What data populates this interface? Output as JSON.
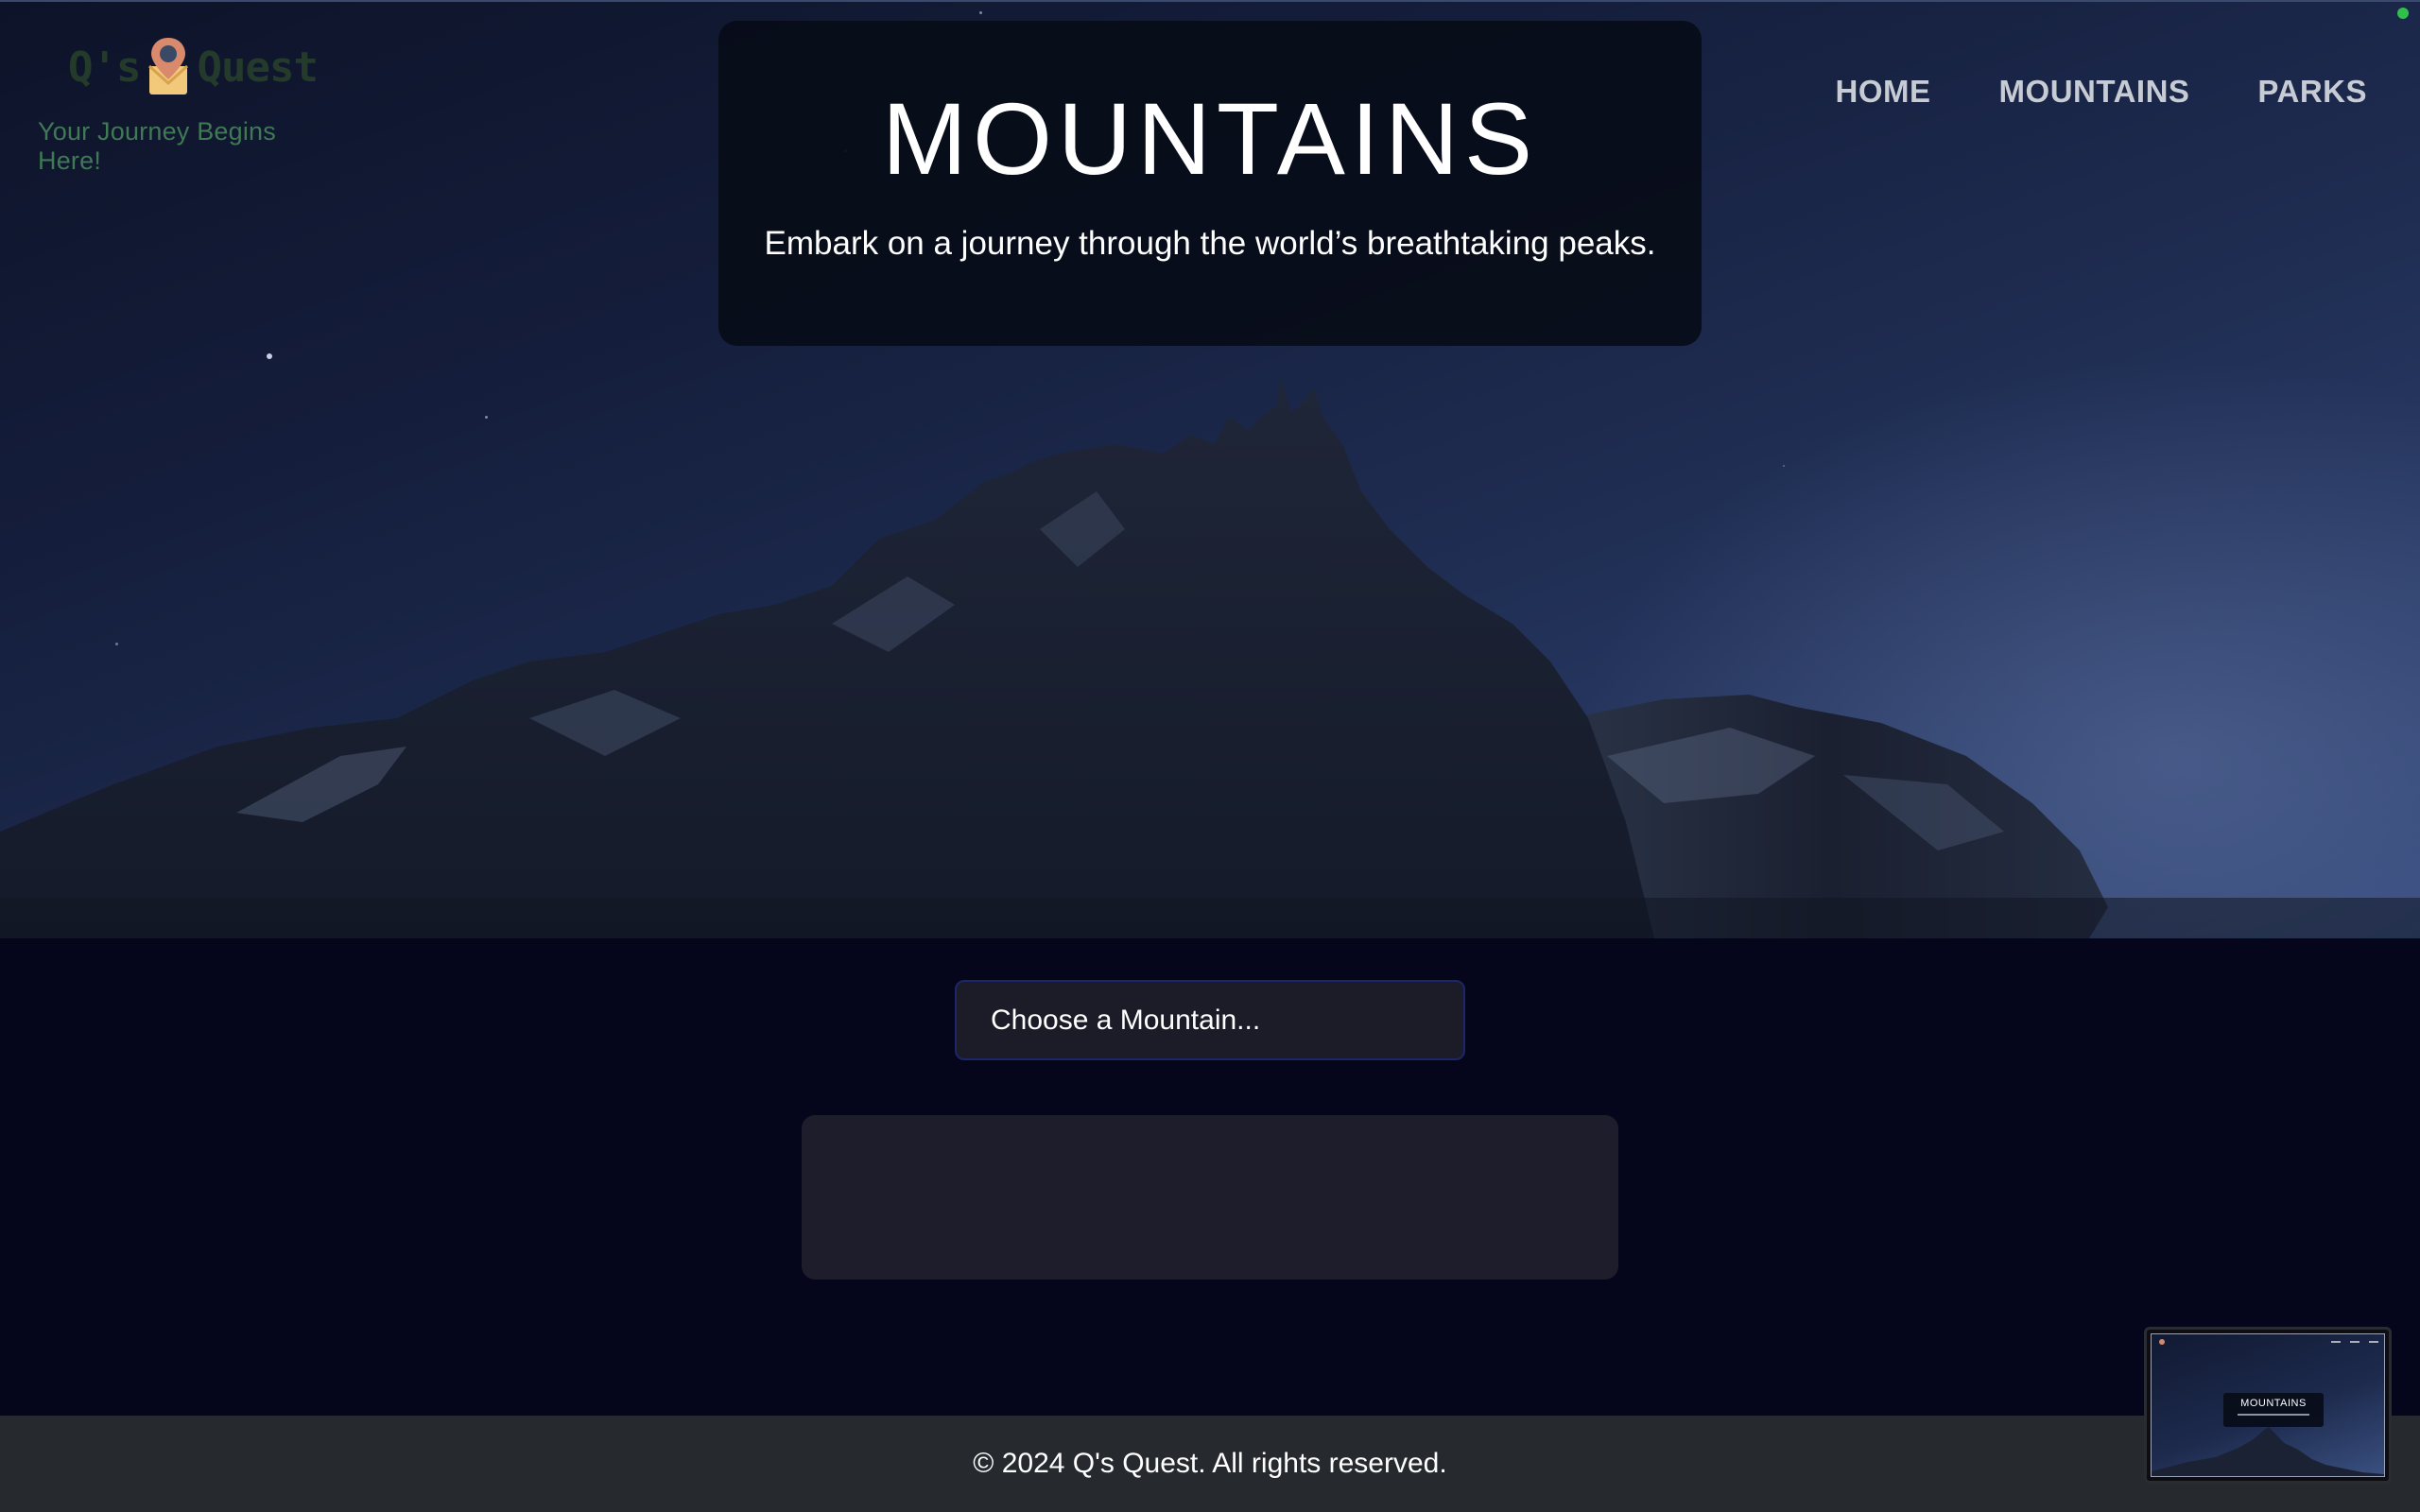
{
  "brand": {
    "name_left": "Q's",
    "name_right": "Quest",
    "tagline": "Your Journey Begins Here!",
    "logo_icon": "location-pin-icon"
  },
  "nav": {
    "items": [
      {
        "label": "HOME"
      },
      {
        "label": "MOUNTAINS"
      },
      {
        "label": "PARKS"
      }
    ]
  },
  "hero": {
    "title": "MOUNTAINS",
    "subtitle": "Embark on a journey through the world’s breathtaking peaks."
  },
  "selector": {
    "selected": "Choose a Mountain..."
  },
  "footer": {
    "text": "© 2024 Q's Quest. All rights reserved."
  },
  "preview": {
    "title": "MOUNTAINS"
  },
  "colors": {
    "page_background": "#05051c",
    "footer_background": "#26292e",
    "select_border": "#1e2668",
    "brand_green": "#3f7a55",
    "status_dot": "#2fbf4a"
  }
}
